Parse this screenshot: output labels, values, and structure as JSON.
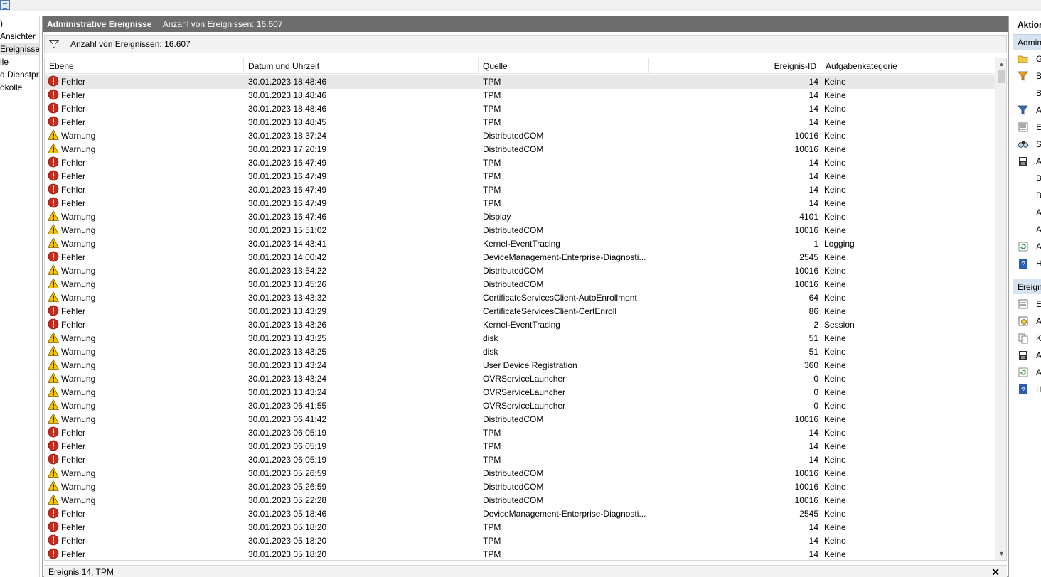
{
  "tree": {
    "items": [
      {
        "label": ")",
        "selected": false
      },
      {
        "label": " Ansichter",
        "selected": false
      },
      {
        "label": " Ereignisse",
        "selected": true
      },
      {
        "label": "lle",
        "selected": false
      },
      {
        "label": "d Dienstpro",
        "selected": false
      },
      {
        "label": "okolle",
        "selected": false
      }
    ]
  },
  "center": {
    "title": "Administrative Ereignisse",
    "count": "Anzahl von Ereignissen: 16.607",
    "filter_text": "Anzahl von Ereignissen: 16.607",
    "columns": [
      "Ebene",
      "Datum und Uhrzeit",
      "Quelle",
      "Ereignis-ID",
      "Aufgabenkategorie"
    ],
    "rows": [
      {
        "level": "Fehler",
        "type": "error",
        "date": "30.01.2023 18:48:46",
        "source": "TPM",
        "id": "14",
        "category": "Keine"
      },
      {
        "level": "Fehler",
        "type": "error",
        "date": "30.01.2023 18:48:46",
        "source": "TPM",
        "id": "14",
        "category": "Keine"
      },
      {
        "level": "Fehler",
        "type": "error",
        "date": "30.01.2023 18:48:46",
        "source": "TPM",
        "id": "14",
        "category": "Keine"
      },
      {
        "level": "Fehler",
        "type": "error",
        "date": "30.01.2023 18:48:45",
        "source": "TPM",
        "id": "14",
        "category": "Keine"
      },
      {
        "level": "Warnung",
        "type": "warning",
        "date": "30.01.2023 18:37:24",
        "source": "DistributedCOM",
        "id": "10016",
        "category": "Keine"
      },
      {
        "level": "Warnung",
        "type": "warning",
        "date": "30.01.2023 17:20:19",
        "source": "DistributedCOM",
        "id": "10016",
        "category": "Keine"
      },
      {
        "level": "Fehler",
        "type": "error",
        "date": "30.01.2023 16:47:49",
        "source": "TPM",
        "id": "14",
        "category": "Keine"
      },
      {
        "level": "Fehler",
        "type": "error",
        "date": "30.01.2023 16:47:49",
        "source": "TPM",
        "id": "14",
        "category": "Keine"
      },
      {
        "level": "Fehler",
        "type": "error",
        "date": "30.01.2023 16:47:49",
        "source": "TPM",
        "id": "14",
        "category": "Keine"
      },
      {
        "level": "Fehler",
        "type": "error",
        "date": "30.01.2023 16:47:49",
        "source": "TPM",
        "id": "14",
        "category": "Keine"
      },
      {
        "level": "Warnung",
        "type": "warning",
        "date": "30.01.2023 16:47:46",
        "source": "Display",
        "id": "4101",
        "category": "Keine"
      },
      {
        "level": "Warnung",
        "type": "warning",
        "date": "30.01.2023 15:51:02",
        "source": "DistributedCOM",
        "id": "10016",
        "category": "Keine"
      },
      {
        "level": "Warnung",
        "type": "warning",
        "date": "30.01.2023 14:43:41",
        "source": "Kernel-EventTracing",
        "id": "1",
        "category": "Logging"
      },
      {
        "level": "Fehler",
        "type": "error",
        "date": "30.01.2023 14:00:42",
        "source": "DeviceManagement-Enterprise-Diagnosti...",
        "id": "2545",
        "category": "Keine"
      },
      {
        "level": "Warnung",
        "type": "warning",
        "date": "30.01.2023 13:54:22",
        "source": "DistributedCOM",
        "id": "10016",
        "category": "Keine"
      },
      {
        "level": "Warnung",
        "type": "warning",
        "date": "30.01.2023 13:45:26",
        "source": "DistributedCOM",
        "id": "10016",
        "category": "Keine"
      },
      {
        "level": "Warnung",
        "type": "warning",
        "date": "30.01.2023 13:43:32",
        "source": "CertificateServicesClient-AutoEnrollment",
        "id": "64",
        "category": "Keine"
      },
      {
        "level": "Fehler",
        "type": "error",
        "date": "30.01.2023 13:43:29",
        "source": "CertificateServicesClient-CertEnroll",
        "id": "86",
        "category": "Keine"
      },
      {
        "level": "Fehler",
        "type": "error",
        "date": "30.01.2023 13:43:26",
        "source": "Kernel-EventTracing",
        "id": "2",
        "category": "Session"
      },
      {
        "level": "Warnung",
        "type": "warning",
        "date": "30.01.2023 13:43:25",
        "source": "disk",
        "id": "51",
        "category": "Keine"
      },
      {
        "level": "Warnung",
        "type": "warning",
        "date": "30.01.2023 13:43:25",
        "source": "disk",
        "id": "51",
        "category": "Keine"
      },
      {
        "level": "Warnung",
        "type": "warning",
        "date": "30.01.2023 13:43:24",
        "source": "User Device Registration",
        "id": "360",
        "category": "Keine"
      },
      {
        "level": "Warnung",
        "type": "warning",
        "date": "30.01.2023 13:43:24",
        "source": "OVRServiceLauncher",
        "id": "0",
        "category": "Keine"
      },
      {
        "level": "Warnung",
        "type": "warning",
        "date": "30.01.2023 13:43:24",
        "source": "OVRServiceLauncher",
        "id": "0",
        "category": "Keine"
      },
      {
        "level": "Warnung",
        "type": "warning",
        "date": "30.01.2023 06:41:55",
        "source": "OVRServiceLauncher",
        "id": "0",
        "category": "Keine"
      },
      {
        "level": "Warnung",
        "type": "warning",
        "date": "30.01.2023 06:41:42",
        "source": "DistributedCOM",
        "id": "10016",
        "category": "Keine"
      },
      {
        "level": "Fehler",
        "type": "error",
        "date": "30.01.2023 06:05:19",
        "source": "TPM",
        "id": "14",
        "category": "Keine"
      },
      {
        "level": "Fehler",
        "type": "error",
        "date": "30.01.2023 06:05:19",
        "source": "TPM",
        "id": "14",
        "category": "Keine"
      },
      {
        "level": "Fehler",
        "type": "error",
        "date": "30.01.2023 06:05:19",
        "source": "TPM",
        "id": "14",
        "category": "Keine"
      },
      {
        "level": "Warnung",
        "type": "warning",
        "date": "30.01.2023 05:26:59",
        "source": "DistributedCOM",
        "id": "10016",
        "category": "Keine"
      },
      {
        "level": "Warnung",
        "type": "warning",
        "date": "30.01.2023 05:26:59",
        "source": "DistributedCOM",
        "id": "10016",
        "category": "Keine"
      },
      {
        "level": "Warnung",
        "type": "warning",
        "date": "30.01.2023 05:22:28",
        "source": "DistributedCOM",
        "id": "10016",
        "category": "Keine"
      },
      {
        "level": "Fehler",
        "type": "error",
        "date": "30.01.2023 05:18:46",
        "source": "DeviceManagement-Enterprise-Diagnosti...",
        "id": "2545",
        "category": "Keine"
      },
      {
        "level": "Fehler",
        "type": "error",
        "date": "30.01.2023 05:18:20",
        "source": "TPM",
        "id": "14",
        "category": "Keine"
      },
      {
        "level": "Fehler",
        "type": "error",
        "date": "30.01.2023 05:18:20",
        "source": "TPM",
        "id": "14",
        "category": "Keine"
      },
      {
        "level": "Fehler",
        "type": "error",
        "date": "30.01.2023 05:18:20",
        "source": "TPM",
        "id": "14",
        "category": "Keine"
      }
    ],
    "detail_title": "Ereignis 14, TPM",
    "close_glyph": "✕"
  },
  "actions": {
    "header": "Aktion",
    "section1": "Admin",
    "section1_items": [
      {
        "label": "G",
        "icon": "open-folder-icon"
      },
      {
        "label": "B",
        "icon": "filter-edit-icon"
      },
      {
        "label": "B",
        "icon": ""
      },
      {
        "label": "A",
        "icon": "filter-icon"
      },
      {
        "label": "Ei",
        "icon": "properties-icon"
      },
      {
        "label": "S",
        "icon": "find-icon"
      },
      {
        "label": "A",
        "icon": "save-icon"
      },
      {
        "label": "B",
        "icon": ""
      },
      {
        "label": "B",
        "icon": ""
      },
      {
        "label": "A",
        "icon": ""
      },
      {
        "label": "A",
        "icon": ""
      },
      {
        "label": "A",
        "icon": "refresh-icon"
      },
      {
        "label": "H",
        "icon": "help-icon"
      }
    ],
    "section2": "Ereign",
    "section2_items": [
      {
        "label": "Er",
        "icon": "event-properties-icon"
      },
      {
        "label": "A",
        "icon": "attach-task-icon"
      },
      {
        "label": "K",
        "icon": "copy-icon"
      },
      {
        "label": "A",
        "icon": "save-icon"
      },
      {
        "label": "A",
        "icon": "refresh-icon"
      },
      {
        "label": "H",
        "icon": "help-icon"
      }
    ]
  },
  "colors": {
    "header_bg": "#6d6d6d",
    "error_red": "#c42b1c",
    "warning_yellow": "#f5c400",
    "selected_row": "#e8e8e8",
    "section_bg": "#d6e4f2"
  }
}
